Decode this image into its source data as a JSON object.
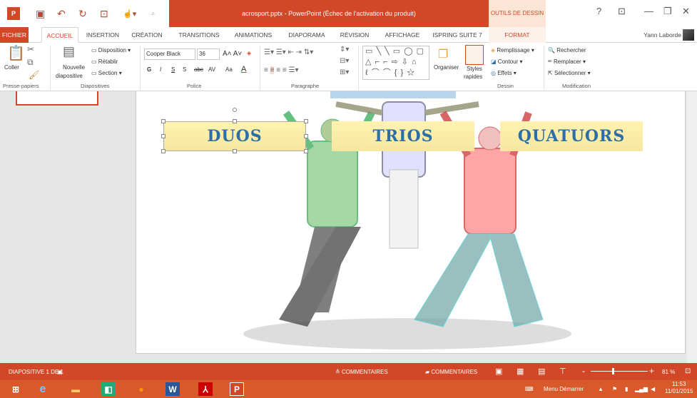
{
  "window": {
    "title": "acrosport.pptx - PowerPoint (Échec de l'activation du produit)",
    "context_tab": "OUTILS DE DESSIN",
    "help": "?",
    "user": "Yann Laborde"
  },
  "tabs": [
    "FICHIER",
    "ACCUEIL",
    "INSERTION",
    "CRÉATION",
    "TRANSITIONS",
    "ANIMATIONS",
    "DIAPORAMA",
    "RÉVISION",
    "AFFICHAGE",
    "ISPRING SUITE 7",
    "FORMAT"
  ],
  "ribbon": {
    "clipboard": {
      "paste": "Coller",
      "label": "Presse-papiers"
    },
    "slides": {
      "new_slide_1": "Nouvelle",
      "new_slide_2": "diapositive",
      "layout": "Disposition",
      "reset": "Rétablir",
      "section": "Section",
      "label": "Diapositives"
    },
    "font": {
      "name": "Cooper Black",
      "size": "36",
      "label": "Police",
      "bold": "G",
      "italic": "I",
      "underline": "S",
      "strike": "S",
      "abc": "abc",
      "spacing": "AV",
      "case": "Aa",
      "color": "A"
    },
    "paragraph": {
      "label": "Paragraphe"
    },
    "drawing": {
      "arrange": "Organiser",
      "styles_1": "Styles",
      "styles_2": "rapides",
      "fill": "Remplissage",
      "outline": "Contour",
      "effects": "Effets",
      "label": "Dessin"
    },
    "editing": {
      "find": "Rechercher",
      "replace": "Remplacer",
      "select": "Sélectionner",
      "label": "Modification"
    }
  },
  "slide": {
    "boxes": [
      "DUOS",
      "TRIOS",
      "QUATUORS"
    ]
  },
  "status": {
    "slide_info": "DIAPOSITIVE 1 DE 1",
    "notes": "COMMENTAIRES",
    "comments": "COMMENTAIRES",
    "zoom": "81 %"
  },
  "taskbar": {
    "start_menu": "Menu Démarrer",
    "time": "11:53",
    "date": "11/01/2015"
  },
  "colors": {
    "accent": "#d24726",
    "title_text": "#2e6fa3",
    "box_fill": "#fbeeb0"
  }
}
